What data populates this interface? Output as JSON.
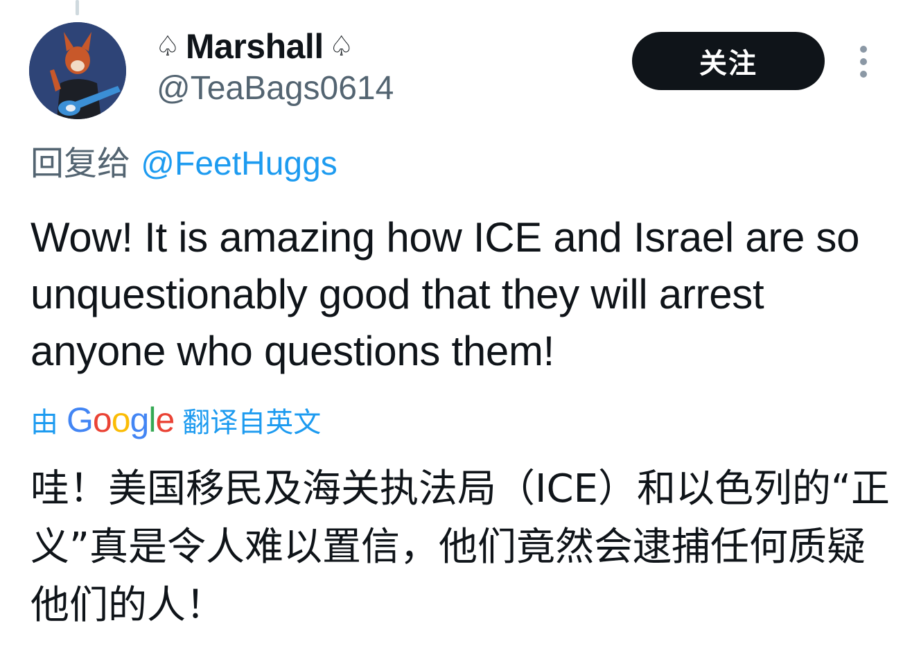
{
  "author": {
    "display_name": "Marshall",
    "name_prefix_glyph": "♤",
    "name_suffix_glyph": "♤",
    "handle": "@TeaBags0614"
  },
  "actions": {
    "follow_label": "关注",
    "more_icon": "more-vertical-icon"
  },
  "reply": {
    "prefix": "回复给 ",
    "mention": "@FeetHuggs"
  },
  "tweet": {
    "text": "Wow! It is amazing how ICE and Israel are so unquestionably good that they will arrest anyone who questions them!"
  },
  "translation": {
    "by_label": "由",
    "provider": "Google",
    "from_label": "翻译自英文",
    "text": "哇！美国移民及海关执法局（ICE）和以色列的“正义”真是令人难以置信，他们竟然会逮捕任何质疑他们的人！"
  },
  "colors": {
    "text_primary": "#0f1419",
    "text_secondary": "#536471",
    "link": "#1d9bf0",
    "button_bg": "#0f1419"
  }
}
